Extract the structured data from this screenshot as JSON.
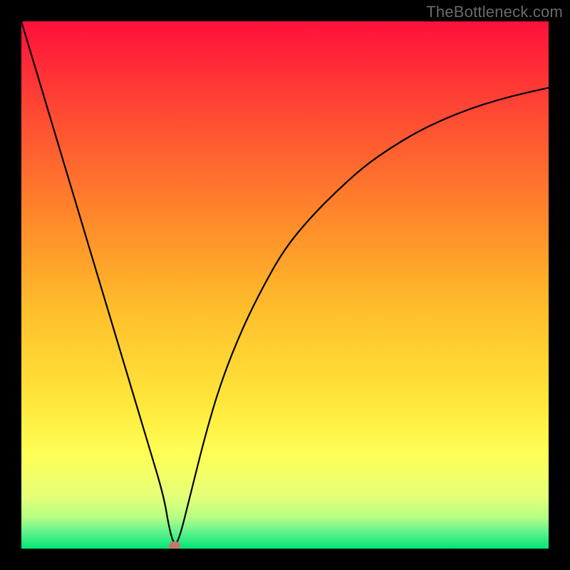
{
  "watermark": "TheBottleneck.com",
  "colors": {
    "frame": "#000000",
    "watermark": "#6a6a6a",
    "curve": "#000000",
    "marker": "#c4776e",
    "gradient_stops": [
      {
        "offset": 0.0,
        "color": "#ff103a"
      },
      {
        "offset": 0.18,
        "color": "#ff4b33"
      },
      {
        "offset": 0.38,
        "color": "#ff8b2a"
      },
      {
        "offset": 0.55,
        "color": "#ffbf2b"
      },
      {
        "offset": 0.72,
        "color": "#ffe63a"
      },
      {
        "offset": 0.82,
        "color": "#feff55"
      },
      {
        "offset": 0.9,
        "color": "#e6ff78"
      },
      {
        "offset": 0.94,
        "color": "#b6ff82"
      },
      {
        "offset": 0.965,
        "color": "#6cf48e"
      },
      {
        "offset": 1.0,
        "color": "#00e676"
      }
    ]
  },
  "chart_data": {
    "type": "line",
    "title": "",
    "xlabel": "",
    "ylabel": "",
    "xlim": [
      0,
      100
    ],
    "ylim": [
      0,
      100
    ],
    "grid": false,
    "legend": false,
    "notes": "Background is a vertical red→orange→yellow→green gradient. A single black curve descends from the top-left to a cusp near the bottom then rises toward the upper-right. A small rounded marker sits at the cusp.",
    "series": [
      {
        "name": "curve",
        "x": [
          0,
          3,
          6,
          9,
          12,
          15,
          18,
          21,
          24,
          27,
          28,
          29,
          30,
          32,
          35,
          38,
          42,
          46,
          50,
          55,
          60,
          65,
          70,
          75,
          80,
          85,
          90,
          95,
          100
        ],
        "y": [
          100,
          90,
          80,
          70,
          60,
          50,
          40,
          30,
          20,
          10,
          4,
          0.5,
          2,
          10,
          22,
          32,
          42,
          50,
          57,
          63,
          68,
          72.5,
          76,
          79,
          81.4,
          83.4,
          85,
          86.3,
          87.4
        ]
      }
    ],
    "marker": {
      "x": 29,
      "y": 0.5
    },
    "annotations": []
  }
}
